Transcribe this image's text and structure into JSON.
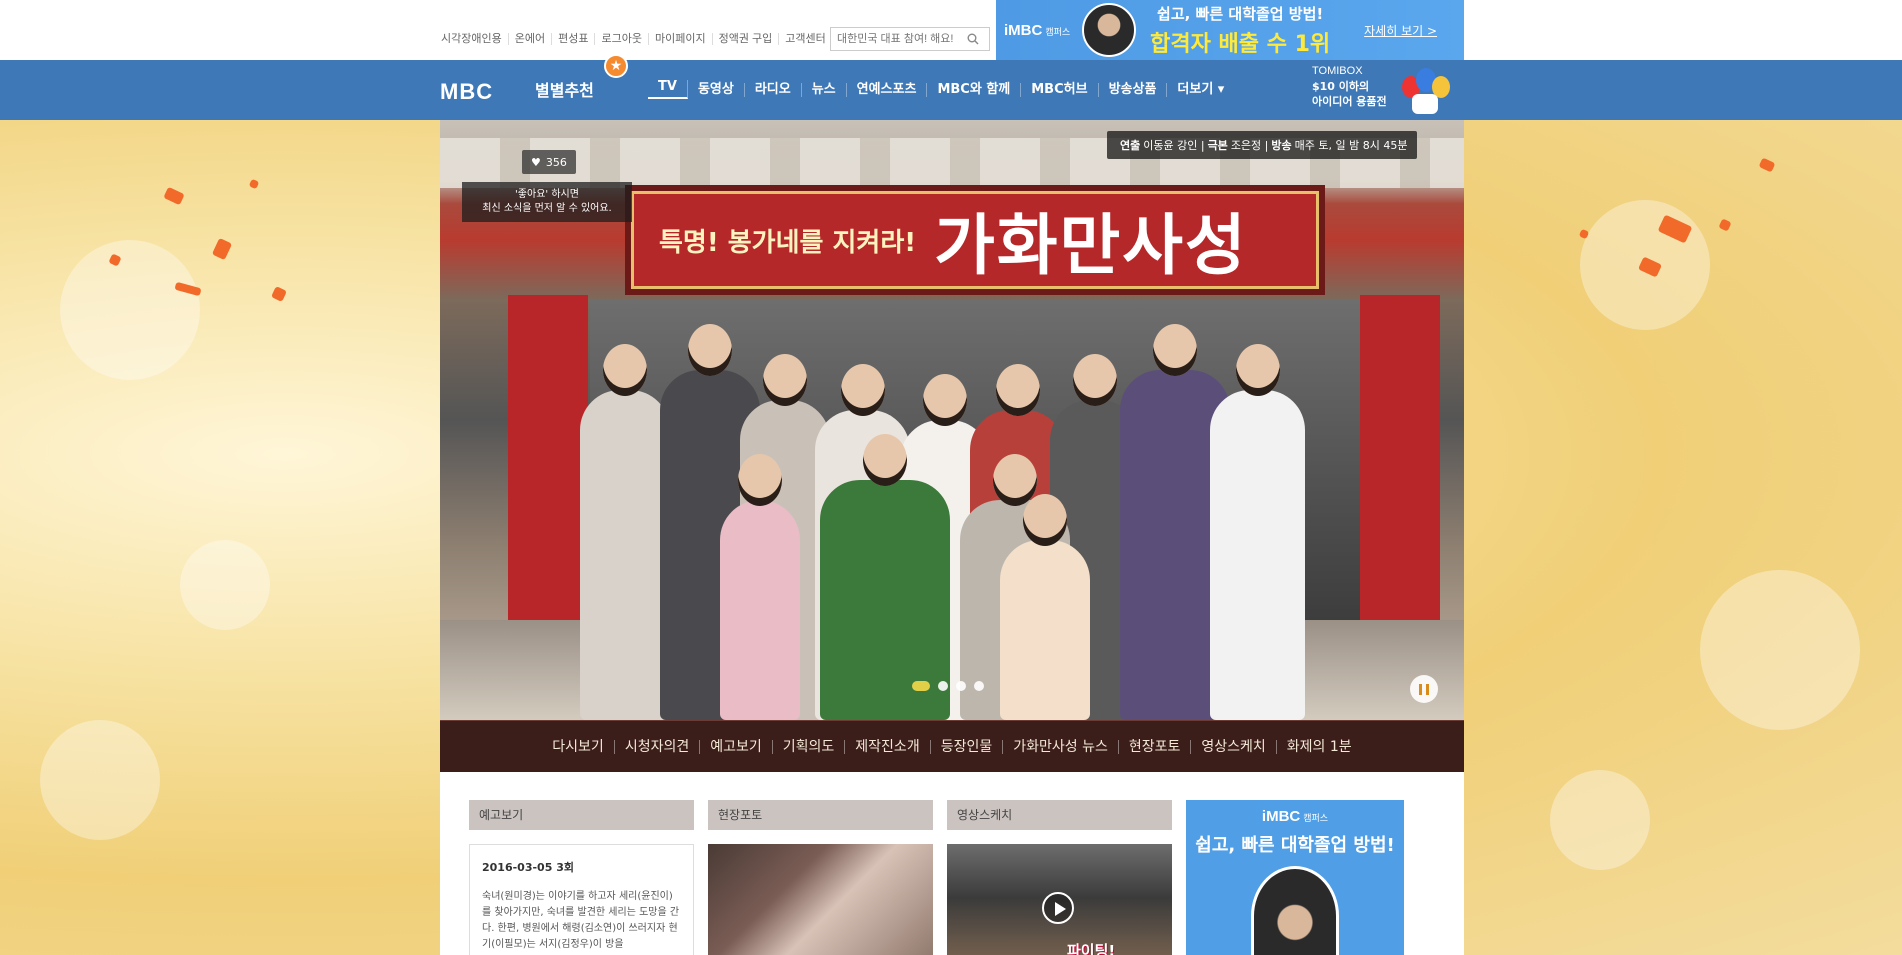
{
  "util": {
    "links": [
      "시각장애인용",
      "온에어",
      "편성표",
      "로그아웃",
      "마이페이지",
      "정액권 구입",
      "고객센터"
    ],
    "search_placeholder": "대한민국 대표 참여! 해요!"
  },
  "top_ad": {
    "logo": "iMBC",
    "logo_sub": "캠퍼스",
    "line1": "쉽고, 빠른 대학졸업 방법!",
    "line2": "합격자 배출 수 1위",
    "more": "자세히 보기 >"
  },
  "nav": {
    "logo": "MBC",
    "star_rec": "별별추천",
    "items": [
      "TV",
      "동영상",
      "라디오",
      "뉴스",
      "연예스포츠",
      "MBC와 함께",
      "MBC허브",
      "방송상품",
      "더보기 ▾"
    ],
    "tomibox_title": "TOMIBOX",
    "tomibox_line1": "$10 이하의",
    "tomibox_line2": "아이디어 용품전"
  },
  "hero": {
    "likes": "356",
    "likes_tip_line1": "'좋아요' 하시면",
    "likes_tip_line2": "최신 소식을 먼저 알 수 있어요.",
    "credits": {
      "director_label": "연출",
      "director": "이동윤 강인",
      "writer_label": "극본",
      "writer": "조은정",
      "air_label": "방송",
      "air": "매주 토, 일 밤 8시 45분"
    },
    "sign_sub": "특명! 봉가네를 지켜라!",
    "sign_title": "가화만사성"
  },
  "program_menu": [
    "다시보기",
    "시청자의견",
    "예고보기",
    "기획의도",
    "제작진소개",
    "등장인물",
    "가화만사성 뉴스",
    "현장포토",
    "영상스케치",
    "화제의 1분"
  ],
  "content": {
    "col1_title": "예고보기",
    "col2_title": "현장포토",
    "col3_title": "영상스케치",
    "preview_episode": "2016-03-05 3회",
    "preview_desc": "숙녀(원미경)는 이야기를 하고자 세리(윤진이)를 찾아가지만, 숙녀를 발견한 세리는 도망을 간다. 한편, 병원에서 해령(김소연)이 쓰러지자 현기(이필모)는 서지(김정우)이 방을",
    "video_caption": "파이팅!",
    "side_ad_logo": "iMBC",
    "side_ad_logo_sub": "캠퍼스",
    "side_ad_copy": "쉽고, 빠른 대학졸업 방법!"
  },
  "colors": {
    "nav_bg": "#3e78b6",
    "ad_bg": "#4f9ee6",
    "program_menu_bg": "#3b1d1a",
    "accent_yellow": "#ffea3a"
  }
}
